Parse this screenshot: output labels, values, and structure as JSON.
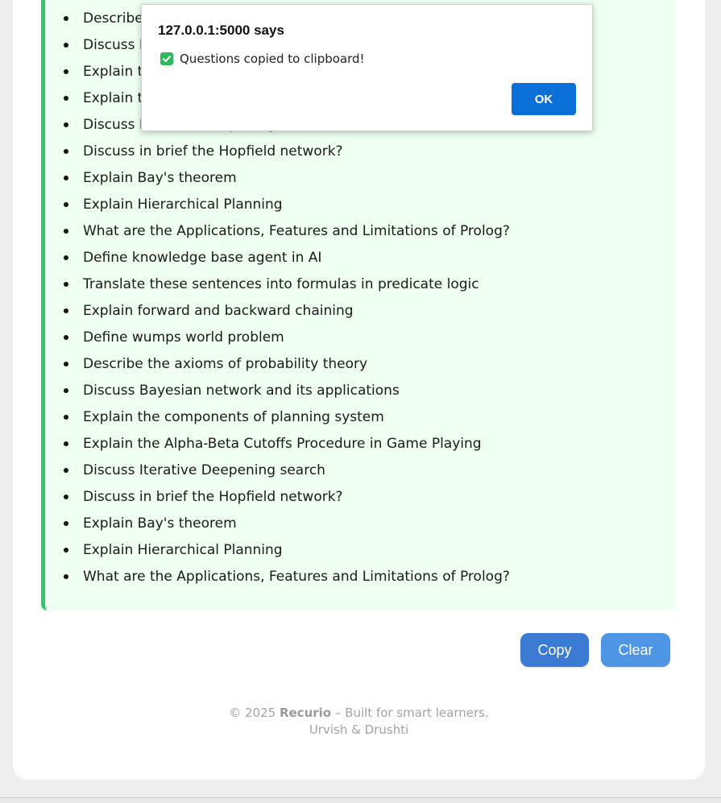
{
  "questions": [
    "Describe the axioms of probability theory",
    "Discuss Bayesian network and its applications",
    "Explain the components of planning system",
    "Explain the Alpha-Beta Cutoffs Procedure in Game Playing",
    "Discuss Iterative Deepening search",
    "Discuss in brief the Hopfield network?",
    "Explain Bay's theorem",
    "Explain Hierarchical Planning",
    "What are the Applications, Features and Limitations of Prolog?",
    "Define knowledge base agent in AI",
    "Translate these sentences into formulas in predicate logic",
    "Explain forward and backward chaining",
    "Define wumps world problem",
    "Describe the axioms of probability theory",
    "Discuss Bayesian network and its applications",
    "Explain the components of planning system",
    "Explain the Alpha-Beta Cutoffs Procedure in Game Playing",
    "Discuss Iterative Deepening search",
    "Discuss in brief the Hopfield network?",
    "Explain Bay's theorem",
    "Explain Hierarchical Planning",
    "What are the Applications, Features and Limitations of Prolog?"
  ],
  "buttons": {
    "copy": "Copy",
    "clear": "Clear"
  },
  "footer": {
    "copyright": "© 2025",
    "brand": "Recurio",
    "tagline": "– Built for smart learners.",
    "authors": "Urvish & Drushti"
  },
  "dialog": {
    "title": "127.0.0.1:5000 says",
    "message": "Questions copied to clipboard!",
    "ok": "OK",
    "icon": "checkbox-checked-icon"
  },
  "colors": {
    "accent_green": "#2fc86a",
    "copy_button": "#3b7bd4",
    "clear_button": "#4f95e6",
    "ok_button": "#0a6fd6"
  }
}
